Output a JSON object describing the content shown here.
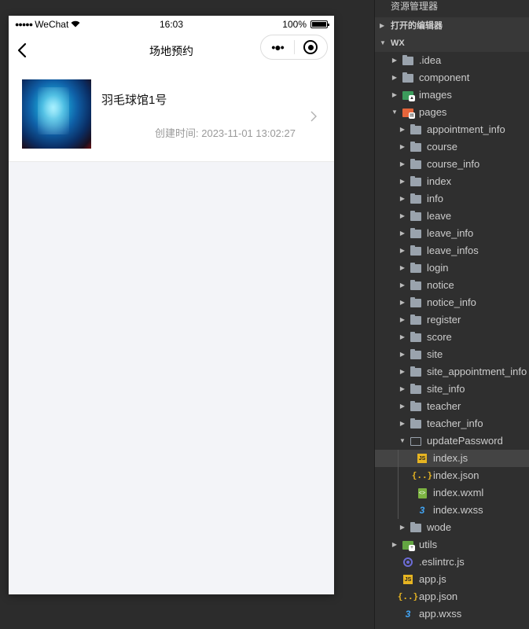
{
  "simulator": {
    "status_bar": {
      "signal": "●●●●●",
      "carrier": "WeChat",
      "wifi_icon": "wifi-icon",
      "time": "16:03",
      "battery_percent": "100%"
    },
    "nav": {
      "title": "场地预约",
      "more_glyph": "•●•"
    },
    "card": {
      "title": "羽毛球馆1号",
      "created_label": "创建时间: 2023-11-01 13:02:27"
    }
  },
  "explorer": {
    "title": "资源管理器",
    "sections": [
      {
        "label": "打开的编辑器",
        "expanded": false
      },
      {
        "label": "WX",
        "expanded": true
      }
    ],
    "tree": [
      {
        "label": ".idea",
        "depth": 1,
        "type": "folder",
        "expanded": false
      },
      {
        "label": "component",
        "depth": 1,
        "type": "folder",
        "expanded": false
      },
      {
        "label": "images",
        "depth": 1,
        "type": "folder-images",
        "expanded": false
      },
      {
        "label": "pages",
        "depth": 1,
        "type": "folder-pages",
        "expanded": true
      },
      {
        "label": "appointment_info",
        "depth": 2,
        "type": "folder",
        "expanded": false
      },
      {
        "label": "course",
        "depth": 2,
        "type": "folder",
        "expanded": false
      },
      {
        "label": "course_info",
        "depth": 2,
        "type": "folder",
        "expanded": false
      },
      {
        "label": "index",
        "depth": 2,
        "type": "folder",
        "expanded": false
      },
      {
        "label": "info",
        "depth": 2,
        "type": "folder",
        "expanded": false
      },
      {
        "label": "leave",
        "depth": 2,
        "type": "folder",
        "expanded": false
      },
      {
        "label": "leave_info",
        "depth": 2,
        "type": "folder",
        "expanded": false
      },
      {
        "label": "leave_infos",
        "depth": 2,
        "type": "folder",
        "expanded": false
      },
      {
        "label": "login",
        "depth": 2,
        "type": "folder",
        "expanded": false
      },
      {
        "label": "notice",
        "depth": 2,
        "type": "folder",
        "expanded": false
      },
      {
        "label": "notice_info",
        "depth": 2,
        "type": "folder",
        "expanded": false
      },
      {
        "label": "register",
        "depth": 2,
        "type": "folder",
        "expanded": false
      },
      {
        "label": "score",
        "depth": 2,
        "type": "folder",
        "expanded": false
      },
      {
        "label": "site",
        "depth": 2,
        "type": "folder",
        "expanded": false
      },
      {
        "label": "site_appointment_info",
        "depth": 2,
        "type": "folder",
        "expanded": false
      },
      {
        "label": "site_info",
        "depth": 2,
        "type": "folder",
        "expanded": false
      },
      {
        "label": "teacher",
        "depth": 2,
        "type": "folder",
        "expanded": false
      },
      {
        "label": "teacher_info",
        "depth": 2,
        "type": "folder",
        "expanded": false
      },
      {
        "label": "updatePassword",
        "depth": 2,
        "type": "folder-open",
        "expanded": true
      },
      {
        "label": "index.js",
        "depth": 3,
        "type": "js",
        "selected": true
      },
      {
        "label": "index.json",
        "depth": 3,
        "type": "json"
      },
      {
        "label": "index.wxml",
        "depth": 3,
        "type": "wxml"
      },
      {
        "label": "index.wxss",
        "depth": 3,
        "type": "wxss"
      },
      {
        "label": "wode",
        "depth": 2,
        "type": "folder",
        "expanded": false
      },
      {
        "label": "utils",
        "depth": 1,
        "type": "folder-utils",
        "expanded": false
      },
      {
        "label": ".eslintrc.js",
        "depth": 1,
        "type": "eslint"
      },
      {
        "label": "app.js",
        "depth": 1,
        "type": "js"
      },
      {
        "label": "app.json",
        "depth": 1,
        "type": "json"
      },
      {
        "label": "app.wxss",
        "depth": 1,
        "type": "wxss"
      }
    ]
  }
}
